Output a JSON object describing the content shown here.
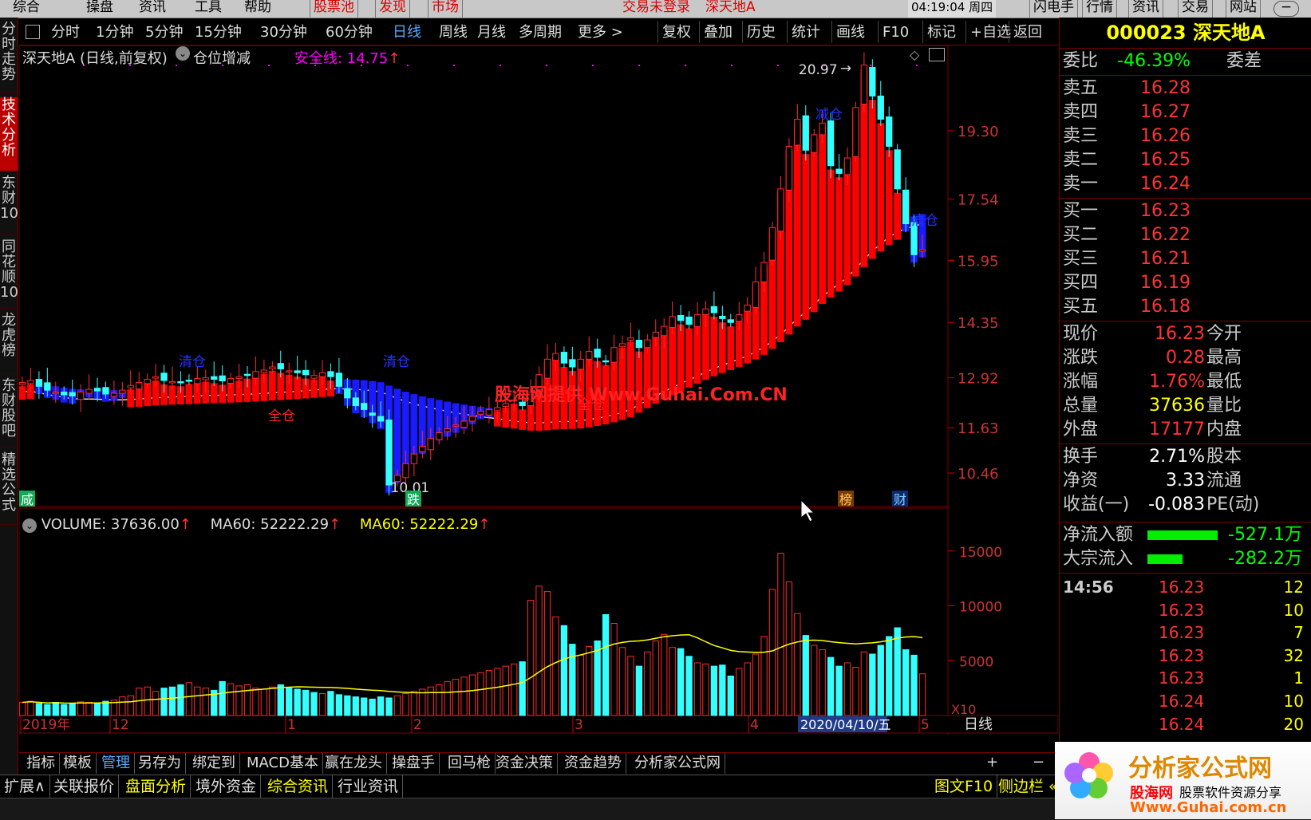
{
  "top_menu": {
    "items": [
      "综合",
      "操盘",
      "资讯",
      "工具",
      "帮助"
    ],
    "red_items": [
      "股票池",
      "发现",
      "市场"
    ],
    "login_status": "交易未登录",
    "stock_name": "深天地A",
    "clock": "04:19:04 周四",
    "right_items": [
      "闪电手",
      "行情",
      "资讯",
      "交易",
      "网站"
    ]
  },
  "left_tabs": [
    "分时走势",
    "技术分析",
    "东财10",
    "同花顺10",
    "龙虎榜",
    "东财股吧",
    "精选公式"
  ],
  "toolbar": {
    "periods": [
      "分时",
      "1分钟",
      "5分钟",
      "15分钟",
      "30分钟",
      "60分钟",
      "日线",
      "周线",
      "月线",
      "多周期",
      "更多 >"
    ],
    "selected_period": "日线",
    "actions": [
      "复权",
      "叠加",
      "历史",
      "统计",
      "画线",
      "F10",
      "标记",
      "+自选",
      "返回"
    ]
  },
  "chart": {
    "title": "深天地A (日线,前复权)",
    "indicator": "仓位增减",
    "safety_line_label": "安全线: 14.75",
    "price_ticks": [
      "19.30",
      "17.54",
      "15.95",
      "14.35",
      "12.92",
      "11.63",
      "10.46"
    ],
    "high_label": "20.97",
    "low_label": "10.01",
    "annotations": [
      "减仓",
      "清仓",
      "清仓",
      "全仓",
      "全仓"
    ],
    "markers": {
      "xian": "咸",
      "die": "跌",
      "bang": "榜",
      "cai": "财"
    },
    "watermark": "股海网提供 Www.Guhai.Com.CN",
    "volume_label": "VOLUME: 37636.00",
    "ma60_label": "MA60: 52222.29",
    "ma60_label2": "MA60: 52222.29",
    "volume_ticks": [
      "15000",
      "10000",
      "5000"
    ],
    "x10": "X10",
    "date_axis": [
      "2019年",
      "12",
      "1",
      "2",
      "3",
      "4",
      "5"
    ],
    "cursor_date": "2020/04/10/五",
    "period_label": "日线",
    "colors": {
      "up": "#ff2a2a",
      "down": "#33ffff",
      "ma": "#dddddd",
      "band_up": "#ff0000",
      "band_down": "#1a1aff"
    }
  },
  "chart_data": {
    "type": "candlestick",
    "title": "深天地A (日线,前复权)",
    "x_range": [
      "2019-11-20",
      "2020-05-06"
    ],
    "ylim": [
      9.8,
      21.3
    ],
    "volume_ylim": [
      0,
      16000
    ],
    "candles_close": [
      12.8,
      12.85,
      12.7,
      12.6,
      12.55,
      12.48,
      12.45,
      12.55,
      12.62,
      12.58,
      12.5,
      12.52,
      12.6,
      12.72,
      12.8,
      12.88,
      12.95,
      12.85,
      12.82,
      12.8,
      12.86,
      12.9,
      12.92,
      12.88,
      12.84,
      12.9,
      12.95,
      13.0,
      13.08,
      13.12,
      13.2,
      13.15,
      13.1,
      13.05,
      13.0,
      12.98,
      13.05,
      12.95,
      12.7,
      12.4,
      12.2,
      12.1,
      11.95,
      11.8,
      10.15,
      10.4,
      10.7,
      10.95,
      11.15,
      11.35,
      11.5,
      11.6,
      11.7,
      11.8,
      11.92,
      12.05,
      12.1,
      12.15,
      12.25,
      12.35,
      12.2,
      12.55,
      13.0,
      13.4,
      13.55,
      13.3,
      13.2,
      13.4,
      13.6,
      13.45,
      13.35,
      13.7,
      13.8,
      13.95,
      13.7,
      13.9,
      14.1,
      14.25,
      14.5,
      14.4,
      14.3,
      14.55,
      14.7,
      14.6,
      14.45,
      14.35,
      14.55,
      14.8,
      15.4,
      15.9,
      16.8,
      17.8,
      18.9,
      19.6,
      18.8,
      19.2,
      19.5,
      18.4,
      18.2,
      18.6,
      19.9,
      21.0,
      20.2,
      19.6,
      18.9,
      17.8,
      16.9,
      16.1,
      16.23
    ],
    "volume": [
      1200,
      1300,
      1100,
      1000,
      1200,
      1000,
      1100,
      1250,
      1200,
      1100,
      1300,
      1400,
      1700,
      1800,
      2500,
      2600,
      2200,
      2500,
      2600,
      2800,
      3000,
      2600,
      2500,
      2300,
      3100,
      2900,
      2700,
      2800,
      2500,
      2400,
      2600,
      2800,
      2500,
      2400,
      2300,
      2100,
      2000,
      2200,
      1900,
      1800,
      1700,
      1600,
      1500,
      1700,
      1600,
      1800,
      2000,
      2200,
      2400,
      2600,
      2800,
      3100,
      3300,
      3500,
      3700,
      3900,
      4100,
      4300,
      4500,
      4700,
      4900,
      10500,
      11800,
      11300,
      9000,
      8200,
      6500,
      5500,
      6300,
      6800,
      9200,
      8400,
      6200,
      5400,
      4500,
      5800,
      6800,
      7400,
      6200,
      6100,
      5400,
      4800,
      4700,
      4500,
      4600,
      3600,
      4300,
      4800,
      5600,
      7200,
      11500,
      14800,
      12200,
      9300,
      7300,
      6400,
      6000,
      5300,
      4500,
      4800,
      4400,
      5800,
      5600,
      6400,
      7200,
      8000,
      6000,
      5500,
      3800
    ],
    "safety_line": 14.75,
    "high": 20.97,
    "low": 10.01
  },
  "right_panel": {
    "code": "000023",
    "name": "深天地A",
    "weibi_label": "委比",
    "weibi_value": "-46.39%",
    "weicha_label": "委差",
    "sells": [
      {
        "label": "卖五",
        "price": "16.28"
      },
      {
        "label": "卖四",
        "price": "16.27"
      },
      {
        "label": "卖三",
        "price": "16.26"
      },
      {
        "label": "卖二",
        "price": "16.25"
      },
      {
        "label": "卖一",
        "price": "16.24"
      }
    ],
    "buys": [
      {
        "label": "买一",
        "price": "16.23"
      },
      {
        "label": "买二",
        "price": "16.22"
      },
      {
        "label": "买三",
        "price": "16.21"
      },
      {
        "label": "买四",
        "price": "16.19"
      },
      {
        "label": "买五",
        "price": "16.18"
      }
    ],
    "quote": [
      {
        "k": "现价",
        "v": "16.23",
        "k2": "今开",
        "c": "r"
      },
      {
        "k": "涨跌",
        "v": "0.28",
        "k2": "最高",
        "c": "r"
      },
      {
        "k": "涨幅",
        "v": "1.76%",
        "k2": "最低",
        "c": "r"
      },
      {
        "k": "总量",
        "v": "37636",
        "k2": "量比",
        "c": "y"
      },
      {
        "k": "外盘",
        "v": "17177",
        "k2": "内盘",
        "c": "r"
      }
    ],
    "fund": [
      {
        "k": "换手",
        "v": "2.71%",
        "k2": "股本"
      },
      {
        "k": "净资",
        "v": "3.33",
        "k2": "流通"
      },
      {
        "k": "收益(一)",
        "v": "-0.083",
        "k2": "PE(动)"
      }
    ],
    "flows": [
      {
        "k": "净流入额",
        "v": "-527.1万"
      },
      {
        "k": "大宗流入",
        "v": "-282.2万"
      }
    ],
    "ticks": [
      {
        "t": "14:56",
        "p": "16.23",
        "q": "12"
      },
      {
        "t": "",
        "p": "16.23",
        "q": "10"
      },
      {
        "t": "",
        "p": "16.23",
        "q": "7"
      },
      {
        "t": "",
        "p": "16.23",
        "q": "32"
      },
      {
        "t": "",
        "p": "16.23",
        "q": "1"
      },
      {
        "t": "",
        "p": "16.24",
        "q": "10"
      },
      {
        "t": "",
        "p": "16.24",
        "q": "20"
      }
    ]
  },
  "bottom_tabs": [
    "指标",
    "模板",
    "管理",
    "另存为",
    "绑定到",
    "MACD基本",
    "赢在龙头",
    "操盘手",
    "回马枪",
    "资金决策",
    "资金趋势",
    "分析家公式网"
  ],
  "bottom_tabs_selected": "管理",
  "bottom_tabs2": [
    "扩展∧",
    "关联报价",
    "盘面分析",
    "境外资金",
    "综合资讯",
    "行业资讯"
  ],
  "bottom_right": [
    "图文F10",
    "侧边栏 «"
  ],
  "logo": {
    "title": "分析家公式网",
    "site": "股海网",
    "slogan": "股票软件资源分享",
    "url": "Www.Guhai.com.cn"
  }
}
